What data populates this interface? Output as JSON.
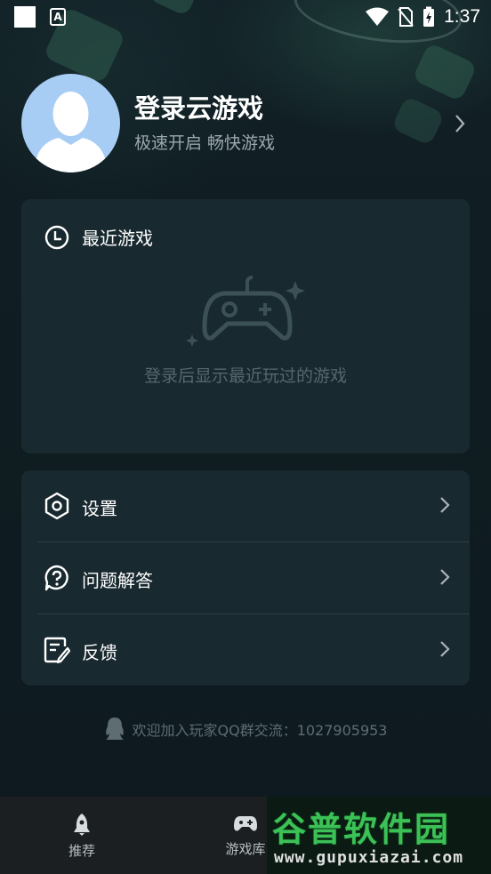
{
  "status_bar": {
    "time": "1:37",
    "icons": [
      "square-icon",
      "a-accessibility-icon",
      "wifi-icon",
      "no-sim-icon",
      "battery-charging-icon"
    ]
  },
  "profile": {
    "title": "登录云游戏",
    "subtitle": "极速开启 畅快游戏"
  },
  "recent": {
    "title": "最近游戏",
    "empty_text": "登录后显示最近玩过的游戏"
  },
  "menu": {
    "items": [
      {
        "label": "设置",
        "icon": "settings-hexagon-icon"
      },
      {
        "label": "问题解答",
        "icon": "help-bubble-icon"
      },
      {
        "label": "反馈",
        "icon": "feedback-edit-icon"
      }
    ]
  },
  "qq_group": {
    "text": "欢迎加入玩家QQ群交流：1027905953"
  },
  "bottom_nav": {
    "items": [
      {
        "label": "推荐",
        "icon": "rocket-icon"
      },
      {
        "label": "游戏库",
        "icon": "gamepad-icon"
      }
    ]
  },
  "watermark": {
    "title": "谷普软件园",
    "url": "www.gupuxiazai.com"
  },
  "colors": {
    "background": "#0e1a1f",
    "card": "#18292f",
    "avatar": "#a8cdf4",
    "watermark_green": "#3fcf5c"
  }
}
